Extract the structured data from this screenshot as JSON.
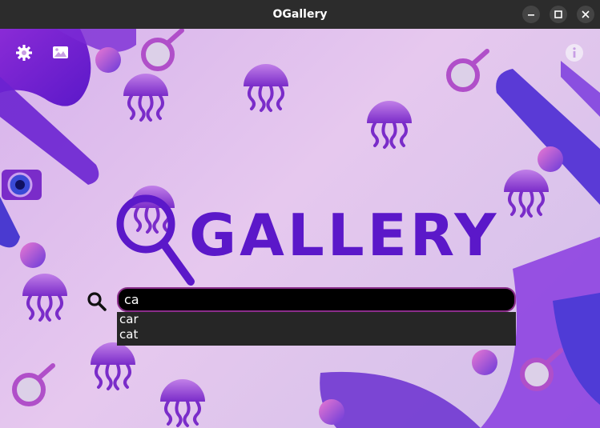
{
  "window": {
    "title": "OGallery"
  },
  "toolbar": {
    "settings_icon": "gear-icon",
    "gallery_icon": "image-icon",
    "info_icon": "info-icon"
  },
  "logo": {
    "text": "OGALLERY"
  },
  "search": {
    "value": "ca",
    "suggestions": [
      "car",
      "cat"
    ]
  },
  "colors": {
    "titlebar": "#2c2c2c",
    "input_border": "#8a2d8a",
    "purple_dark": "#5b18c9",
    "purple_light": "#b26bd9"
  }
}
